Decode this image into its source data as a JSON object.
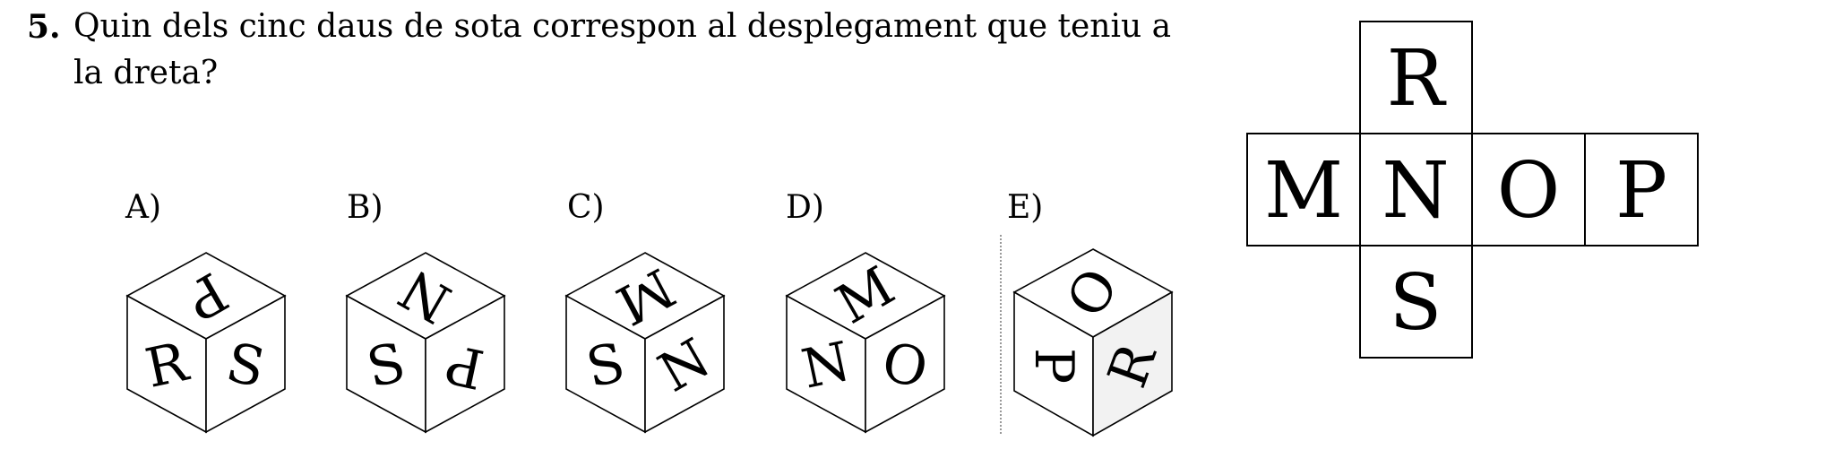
{
  "question": {
    "number": "5.",
    "line1": "Quin dels cinc daus de sota correspon al desplegament que teniu a",
    "line2": "la dreta?"
  },
  "options": [
    {
      "label": "A)",
      "top": "P",
      "left": "R",
      "right": "S"
    },
    {
      "label": "B)",
      "top": "N",
      "left": "S",
      "right": "P"
    },
    {
      "label": "C)",
      "top": "M",
      "left": "S",
      "right": "N"
    },
    {
      "label": "D)",
      "top": "M",
      "left": "N",
      "right": "O"
    },
    {
      "label": "E)",
      "top": "O",
      "left": "P",
      "right": "R"
    }
  ],
  "net": {
    "top": "R",
    "row": [
      "M",
      "N",
      "O",
      "P"
    ],
    "bottom": "S"
  }
}
